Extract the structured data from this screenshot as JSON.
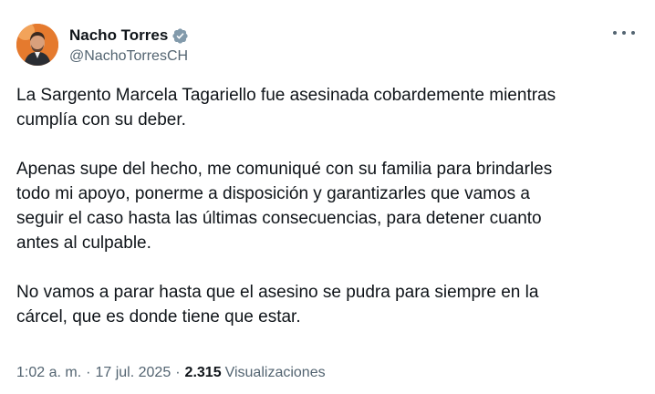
{
  "author": {
    "display_name": "Nacho Torres",
    "handle": "@NachoTorresCH",
    "verified": true
  },
  "tweet": {
    "paragraphs": [
      "La Sargento Marcela Tagariello fue asesinada cobardemente mientras\ncumplía con su deber.",
      "Apenas supe del hecho, me comuniqué con su familia para brindarles\ntodo mi apoyo, ponerme a disposición y garantizarles que vamos a\nseguir el caso hasta las últimas consecuencias, para detener cuanto\nantes al culpable.",
      "No vamos a parar hasta que el asesino se pudra para siempre en la\ncárcel, que es donde tiene que estar."
    ]
  },
  "meta": {
    "time": "1:02 a. m.",
    "separator": "·",
    "date": "17 jul. 2025",
    "views_count": "2.315",
    "views_label": "Visualizaciones"
  },
  "icons": {
    "verified": "verified-badge-icon",
    "more": "more-dots-icon"
  },
  "colors": {
    "text_primary": "#0f1419",
    "text_secondary": "#536471",
    "verified_badge": "#829aab"
  }
}
